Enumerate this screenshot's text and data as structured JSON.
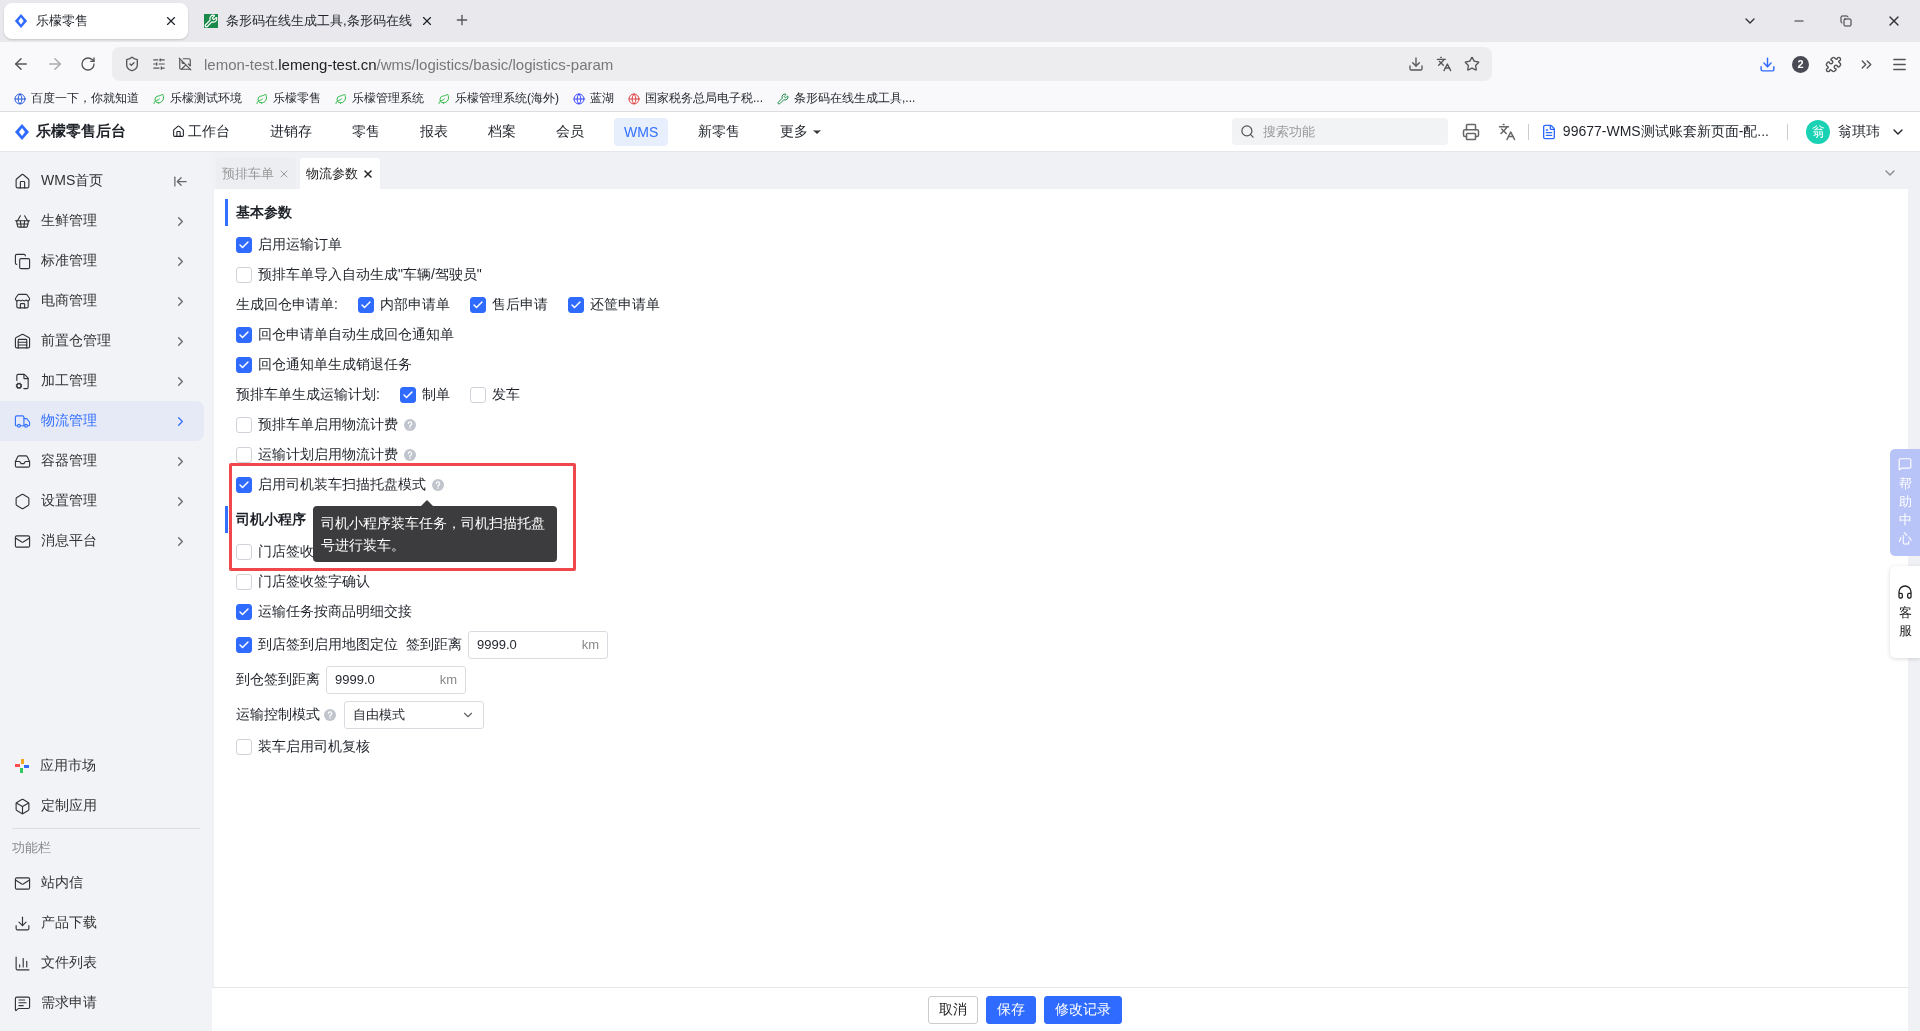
{
  "browser": {
    "tabs": [
      {
        "title": "乐檬零售",
        "selected": true
      },
      {
        "title": "条形码在线生成工具,条形码在线",
        "selected": false
      }
    ],
    "url": "lemon-test.**lemeng-test.cn**/wms/logistics/basic/logistics-param",
    "downloads_badge": "2",
    "bookmarks": [
      "百度一下，你就知道",
      "乐檬测试环境",
      "乐檬零售",
      "乐檬管理系统",
      "乐檬管理系统(海外)",
      "蓝湖",
      "国家税务总局电子税...",
      "条形码在线生成工具,..."
    ]
  },
  "header": {
    "logo": "乐檬零售后台",
    "nav": [
      {
        "label": "工作台",
        "selected": false
      },
      {
        "label": "进销存",
        "selected": false
      },
      {
        "label": "零售",
        "selected": false
      },
      {
        "label": "报表",
        "selected": false
      },
      {
        "label": "档案",
        "selected": false
      },
      {
        "label": "会员",
        "selected": false
      },
      {
        "label": "WMS",
        "selected": true
      },
      {
        "label": "新零售",
        "selected": false
      },
      {
        "label": "更多",
        "selected": false
      }
    ],
    "search": {
      "placeholder": "搜索功能"
    },
    "account": "99677-WMS测试账套新页面-配...",
    "avatar": "翁",
    "user": "翁琪玮"
  },
  "sidebar": {
    "items": [
      {
        "label": "WMS首页",
        "selected": false
      },
      {
        "label": "生鲜管理",
        "selected": false
      },
      {
        "label": "标准管理",
        "selected": false
      },
      {
        "label": "电商管理",
        "selected": false
      },
      {
        "label": "前置仓管理",
        "selected": false
      },
      {
        "label": "加工管理",
        "selected": false
      },
      {
        "label": "物流管理",
        "selected": true
      },
      {
        "label": "容器管理",
        "selected": false
      },
      {
        "label": "设置管理",
        "selected": false
      },
      {
        "label": "消息平台",
        "selected": false
      }
    ],
    "apps": [
      "应用市场",
      "定制应用"
    ],
    "tools_title": "功能栏",
    "tools": [
      "站内信",
      "产品下载",
      "文件列表",
      "需求申请"
    ]
  },
  "page_tabs": [
    {
      "label": "预排车单",
      "selected": false
    },
    {
      "label": "物流参数",
      "selected": true
    }
  ],
  "sections": [
    {
      "title": "基本参数",
      "rows": [
        {
          "kind": "checkbox",
          "label": "启用运输订单",
          "checked": true
        },
        {
          "kind": "checkbox",
          "label": "预排车单导入自动生成\"车辆/驾驶员\"",
          "checked": false
        },
        {
          "kind": "group",
          "label": "生成回仓申请单:",
          "options": [
            {
              "label": "内部申请单",
              "checked": true
            },
            {
              "label": "售后申请",
              "checked": true
            },
            {
              "label": "还筐申请单",
              "checked": true
            }
          ]
        },
        {
          "kind": "checkbox",
          "label": "回仓申请单自动生成回仓通知单",
          "checked": true
        },
        {
          "kind": "checkbox",
          "label": "回仓通知单生成销退任务",
          "checked": true
        },
        {
          "kind": "group",
          "label": "预排车单生成运输计划:",
          "options": [
            {
              "label": "制单",
              "checked": true
            },
            {
              "label": "发车",
              "checked": false
            }
          ]
        },
        {
          "kind": "checkbox",
          "label": "预排车单启用物流计费",
          "checked": false,
          "help": true
        },
        {
          "kind": "checkbox",
          "label": "运输计划启用物流计费",
          "checked": false,
          "help": true
        },
        {
          "kind": "checkbox",
          "label": "启用司机装车扫描托盘模式",
          "checked": true,
          "help": true
        }
      ]
    },
    {
      "title": "司机小程序",
      "rows": [
        {
          "kind": "checkbox",
          "label": "门店签收",
          "checked": false
        },
        {
          "kind": "checkbox",
          "label": "门店签收签字确认",
          "checked": false
        },
        {
          "kind": "checkbox",
          "label": "运输任务按商品明细交接",
          "checked": true
        },
        {
          "kind": "checkbox_input",
          "label": "到店签到启用地图定位",
          "checked": true,
          "input_label": "签到距离",
          "value": "9999.0",
          "unit": "km"
        },
        {
          "kind": "input",
          "label": "到仓签到距离",
          "value": "9999.0",
          "unit": "km"
        },
        {
          "kind": "select",
          "label": "运输控制模式",
          "help": true,
          "value": "自由模式"
        },
        {
          "kind": "checkbox",
          "label": "装车启用司机复核",
          "checked": false
        }
      ]
    }
  ],
  "tooltip": "司机小程序装车任务，司机扫描托盘号进行装车。",
  "float_buttons": [
    {
      "label": "帮助中心",
      "kind": "help"
    },
    {
      "label": "客服",
      "kind": "service"
    }
  ],
  "footer_buttons": [
    {
      "label": "取消",
      "primary": false
    },
    {
      "label": "保存",
      "primary": true
    },
    {
      "label": "修改记录",
      "primary": true
    }
  ]
}
